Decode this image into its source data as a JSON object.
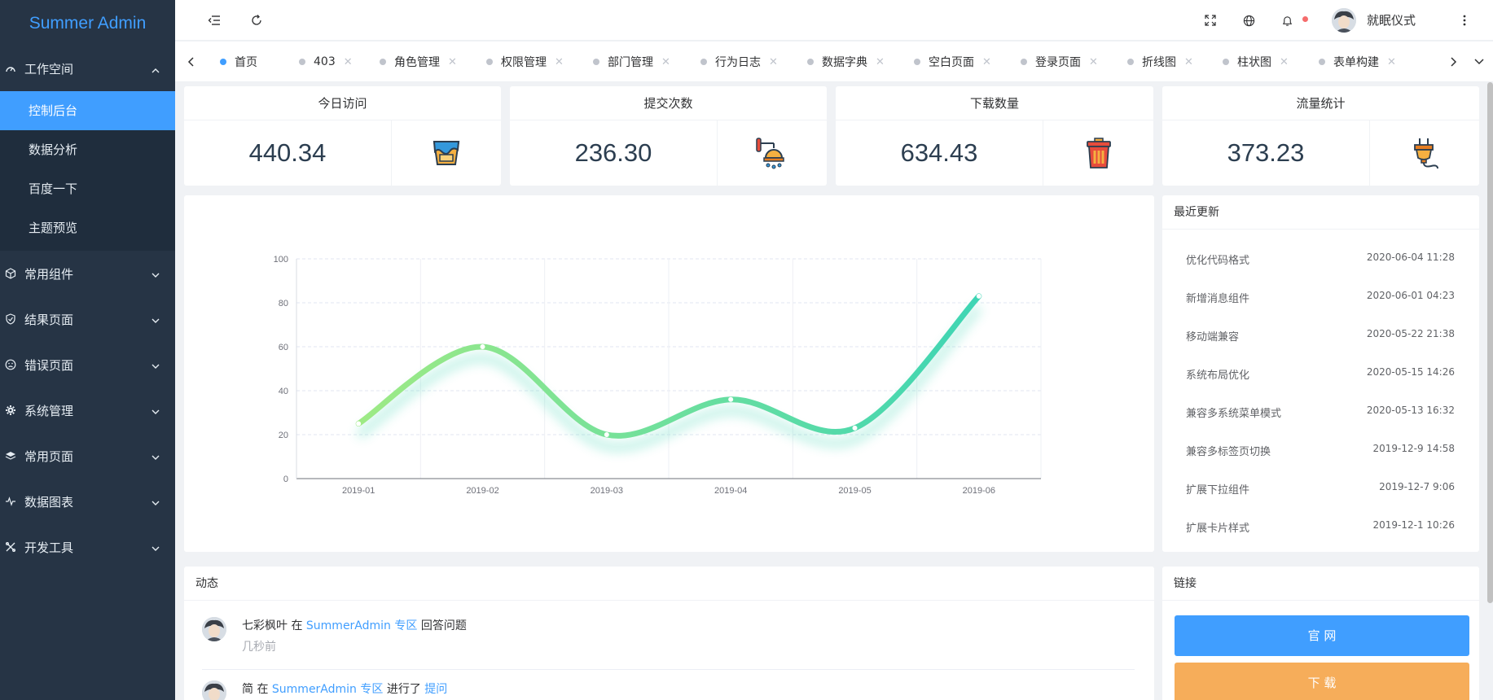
{
  "app": {
    "title": "Summer Admin"
  },
  "sidebar": {
    "groups": [
      {
        "label": "工作空间",
        "icon": "dashboard-icon",
        "expanded": true,
        "items": [
          {
            "label": "控制后台",
            "active": true
          },
          {
            "label": "数据分析"
          },
          {
            "label": "百度一下"
          },
          {
            "label": "主题预览"
          }
        ]
      },
      {
        "label": "常用组件",
        "icon": "cube-icon"
      },
      {
        "label": "结果页面",
        "icon": "shield-check-icon"
      },
      {
        "label": "错误页面",
        "icon": "sad-face-icon"
      },
      {
        "label": "系统管理",
        "icon": "gear-icon"
      },
      {
        "label": "常用页面",
        "icon": "layers-icon"
      },
      {
        "label": "数据图表",
        "icon": "pulse-icon"
      },
      {
        "label": "开发工具",
        "icon": "tools-icon"
      }
    ]
  },
  "header": {
    "user_name": "就眠仪式",
    "icons": [
      "collapse-menu-icon",
      "refresh-icon",
      "fullscreen-icon",
      "globe-icon",
      "bell-icon",
      "more-vertical-icon"
    ]
  },
  "tabs": [
    {
      "label": "首页",
      "active": true,
      "closable": false
    },
    {
      "label": "403",
      "closable": true
    },
    {
      "label": "角色管理",
      "closable": true
    },
    {
      "label": "权限管理",
      "closable": true
    },
    {
      "label": "部门管理",
      "closable": true
    },
    {
      "label": "行为日志",
      "closable": true
    },
    {
      "label": "数据字典",
      "closable": true
    },
    {
      "label": "空白页面",
      "closable": true
    },
    {
      "label": "登录页面",
      "closable": true
    },
    {
      "label": "折线图",
      "closable": true
    },
    {
      "label": "柱状图",
      "closable": true
    },
    {
      "label": "表单构建",
      "closable": true
    }
  ],
  "stats": [
    {
      "title": "今日访问",
      "value": "440.34",
      "icon": "paint-bucket-icon"
    },
    {
      "title": "提交次数",
      "value": "236.30",
      "icon": "shower-icon"
    },
    {
      "title": "下载数量",
      "value": "634.43",
      "icon": "trash-bin-icon"
    },
    {
      "title": "流量统计",
      "value": "373.23",
      "icon": "plug-icon"
    }
  ],
  "chart_data": {
    "type": "line",
    "categories": [
      "2019-01",
      "2019-02",
      "2019-03",
      "2019-04",
      "2019-05",
      "2019-06"
    ],
    "series": [
      {
        "values": [
          25,
          60,
          20,
          36,
          23,
          83
        ]
      }
    ],
    "ylim": [
      0,
      100
    ],
    "yticks": [
      0,
      20,
      40,
      60,
      80,
      100
    ],
    "smooth": true,
    "grid": true,
    "colors": {
      "start": "#9eea85",
      "end": "#3ed5b4"
    }
  },
  "updates": {
    "title": "最近更新",
    "rows": [
      {
        "title": "优化代码格式",
        "time": "2020-06-04 11:28"
      },
      {
        "title": "新增消息组件",
        "time": "2020-06-01 04:23"
      },
      {
        "title": "移动端兼容",
        "time": "2020-05-22 21:38"
      },
      {
        "title": "系统布局优化",
        "time": "2020-05-15 14:26"
      },
      {
        "title": "兼容多系统菜单模式",
        "time": "2020-05-13 16:32"
      },
      {
        "title": "兼容多标签页切换",
        "time": "2019-12-9 14:58"
      },
      {
        "title": "扩展下拉组件",
        "time": "2019-12-7 9:06"
      },
      {
        "title": "扩展卡片样式",
        "time": "2019-12-1 10:26"
      }
    ]
  },
  "activity": {
    "title": "动态",
    "rows": [
      {
        "user": "七彩枫叶",
        "pre": "在",
        "link": "SummerAdmin 专区",
        "action": "回答问题",
        "action_link": "",
        "time": "几秒前"
      },
      {
        "user": "简",
        "pre": "在",
        "link": "SummerAdmin 专区",
        "action": "进行了",
        "action_link": "提问",
        "time": ""
      }
    ]
  },
  "links": {
    "title": "链接",
    "buttons": [
      {
        "label": "官 网",
        "color": "#409eff"
      },
      {
        "label": "下 载",
        "color": "#f6ad5a"
      }
    ]
  },
  "colors": {
    "accent": "#409eff",
    "sidebar_bg": "#263445",
    "submenu_bg": "#1f2d3d"
  }
}
